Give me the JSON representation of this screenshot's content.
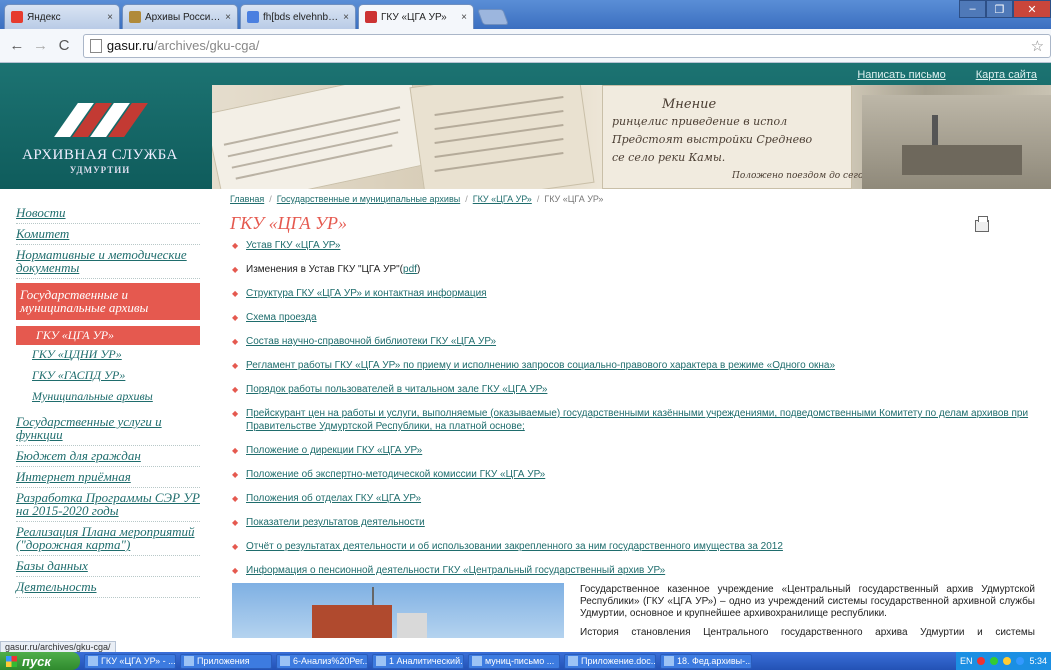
{
  "browser": {
    "tabs": [
      {
        "label": "Яндекс",
        "favicon": "yandex-icon",
        "favicon_color": "#e63b2e"
      },
      {
        "label": "Архивы России. Методиче",
        "favicon": "archive-icon",
        "favicon_color": "#b08a3a"
      },
      {
        "label": "fh[bds elvehnbb - Поиск в G",
        "favicon": "google-icon",
        "favicon_color": "#4a7fe0"
      },
      {
        "label": "ГКУ «ЦГА УР»",
        "favicon": "gasur-icon",
        "favicon_color": "#c33"
      }
    ],
    "active_tab": 3,
    "url_host": "gasur.ru",
    "url_path": "/archives/gku-cga/",
    "window_buttons": [
      "–",
      "❐",
      "✕"
    ]
  },
  "header": {
    "top_links": [
      "Написать письмо",
      "Карта сайта"
    ],
    "org_name": "АРХИВНАЯ СЛУЖБА",
    "org_region": "УДМУРТИИ",
    "logo_colors": [
      "#ffffff",
      "#c33a33",
      "#ffffff",
      "#c33a33"
    ]
  },
  "nav": {
    "items": [
      {
        "label": "Новости"
      },
      {
        "label": "Комитет"
      },
      {
        "label": "Нормативные и методические документы"
      },
      {
        "label": "Государственные и муниципальные архивы",
        "active": true,
        "children": [
          {
            "label": "ГКУ «ЦГА УР»",
            "active": true
          },
          {
            "label": "ГКУ «ЦДНИ УР»"
          },
          {
            "label": "ГКУ «ГАСПД УР»"
          },
          {
            "label": "Муниципальные архивы"
          }
        ]
      },
      {
        "label": "Государственные услуги и функции"
      },
      {
        "label": "Бюджет для граждан"
      },
      {
        "label": "Интернет приёмная"
      },
      {
        "label": "Разработка Программы СЭР УР на 2015-2020 годы"
      },
      {
        "label": "Реализация Плана мероприятий (\"дорожная карта\")"
      },
      {
        "label": "Базы данных"
      },
      {
        "label": "Деятельность"
      }
    ]
  },
  "breadcrumb": [
    "Главная",
    "Государственные и муниципальные архивы",
    "ГКУ «ЦГА УР»",
    "ГКУ «ЦГА УР»"
  ],
  "page_title": "ГКУ «ЦГА УР»",
  "documents": [
    {
      "text": "Устав ГКУ «ЦГА УР»",
      "link": true
    },
    {
      "text": "Изменения в Устав ГКУ \"ЦГА УР\"(",
      "link": false,
      "suffix_link": "pdf",
      "suffix_after": ")"
    },
    {
      "text": "Структура ГКУ «ЦГА УР» и контактная информация",
      "link": true
    },
    {
      "text": "Схема проезда",
      "link": true
    },
    {
      "text": "Состав научно-справочной библиотеки ГКУ «ЦГА УР»",
      "link": true
    },
    {
      "text": "Регламент работы ГКУ «ЦГА УР» по приему и исполнению запросов социально-правового характера в режиме «Одного окна»",
      "link": true
    },
    {
      "text": "Порядок работы пользователей в читальном зале ГКУ «ЦГА УР»",
      "link": true
    },
    {
      "text": "Прейскурант цен на работы и услуги, выполняемые (оказываемые) государственными казёнными учреждениями, подведомственными Комитету по делам архивов при Правительстве Удмуртской Республики, на платной основе;",
      "link": true
    },
    {
      "text": "Положение о дирекции ГКУ «ЦГА УР»",
      "link": true
    },
    {
      "text": "Положение об экспертно-методической комиссии ГКУ «ЦГА УР»",
      "link": true
    },
    {
      "text": "Положения об отделах ГКУ «ЦГА УР»",
      "link": true
    },
    {
      "text": "Показатели результатов деятельности",
      "link": true
    },
    {
      "text": "Отчёт о результатах деятельности и об использовании закрепленного за ним государственного имущества за 2012",
      "link": true
    },
    {
      "text": "Информация о пенсионной деятельности ГКУ «Центральный государственный архив УР»",
      "link": true
    }
  ],
  "about": [
    "Государственное казенное учреждение «Центральный государственный архив Удмуртской Республики» (ГКУ «ЦГА УР») – одно из учреждений системы государственной архивной службы Удмуртии, основное и крупнейшее архивохранилище республики.",
    "История становления Центрального государственного архива Удмуртии и системы государственной архивной службы Удмуртии"
  ],
  "status_url": "gasur.ru/archives/gku-cga/",
  "taskbar": {
    "start": "пуск",
    "items": [
      "ГКУ «ЦГА УР» - ...",
      "Приложения",
      "6-Анализ%20Рег...",
      "1 Аналитический...",
      "муниц-письмо ...",
      "Приложение.doc...",
      "18. Фед.архивы-..."
    ],
    "lang": "EN",
    "time": "5:34"
  }
}
